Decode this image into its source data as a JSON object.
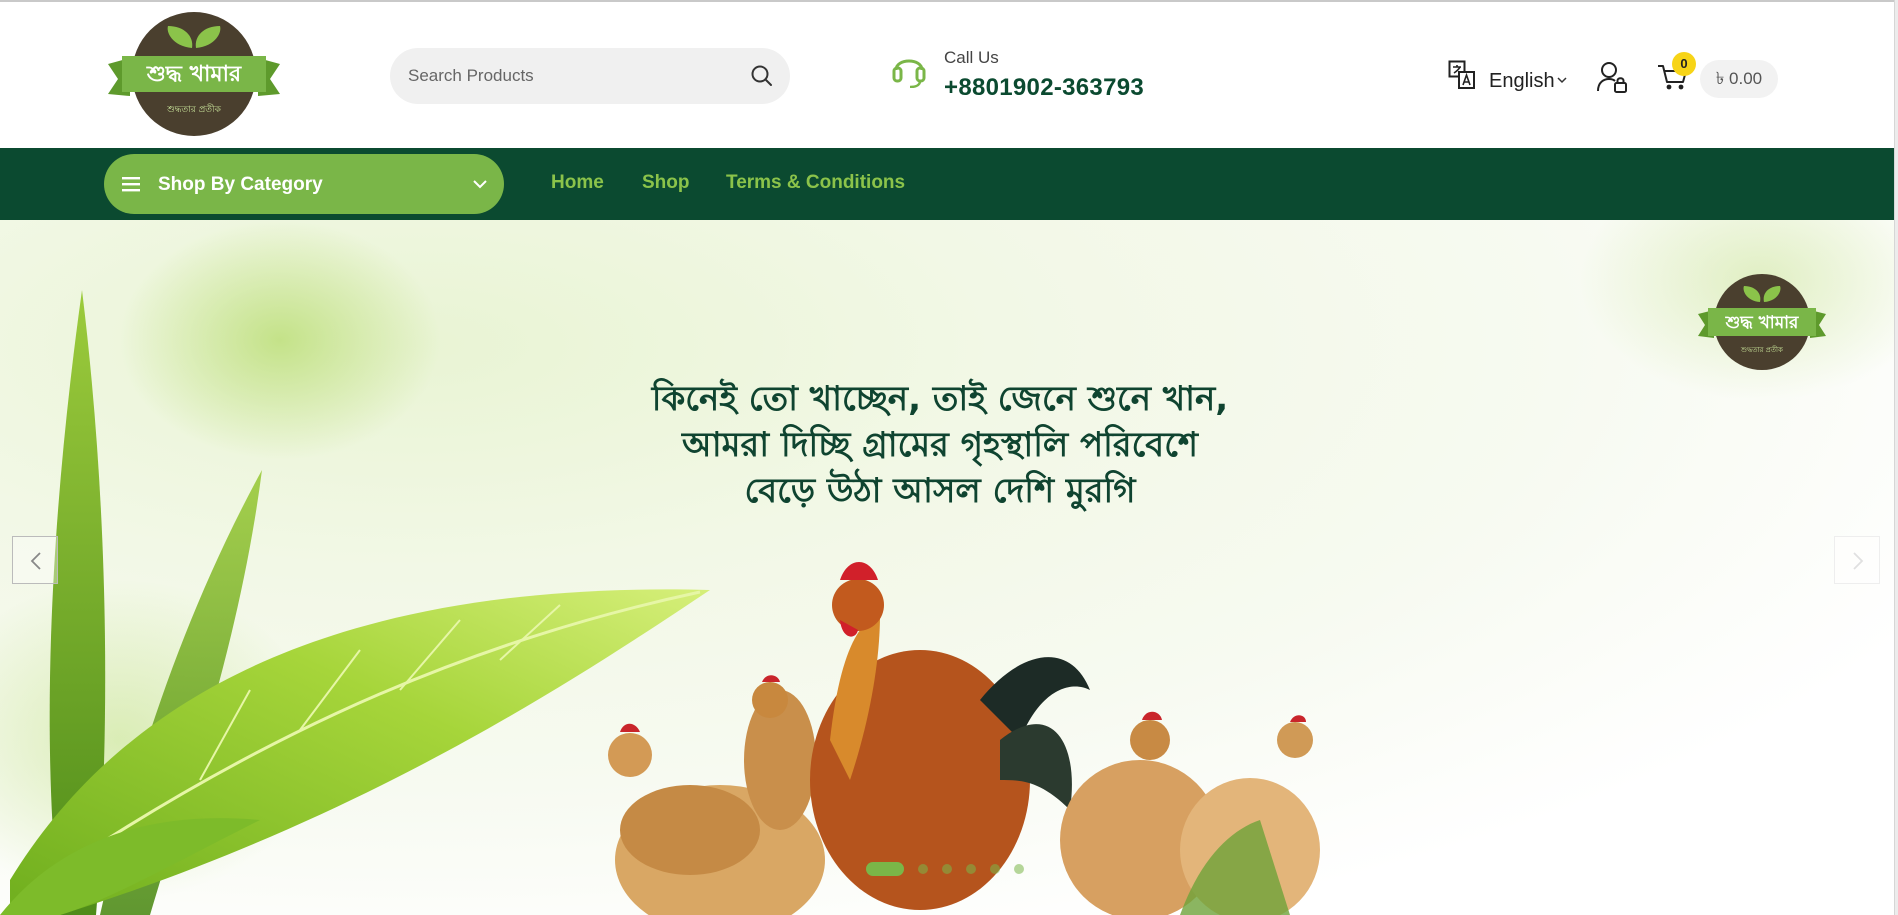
{
  "brand": {
    "logo_text": "শুদ্ধ খামার",
    "logo_tagline": "শুদ্ধতার প্রতীক"
  },
  "search": {
    "placeholder": "Search Products"
  },
  "contact": {
    "label": "Call Us",
    "phone": "+8801902-363793"
  },
  "header_actions": {
    "language": "English",
    "cart_count": "0",
    "cart_total": "৳ 0.00"
  },
  "nav": {
    "category_button": "Shop By Category",
    "links": [
      "Home",
      "Shop",
      "Terms & Conditions"
    ]
  },
  "hero": {
    "lines": [
      "কিনেই তো খাচ্ছেন, তাই জেনে শুনে খান,",
      "আমরা দিচ্ছি গ্রামের গৃহস্থালি পরিবেশে",
      "বেড়ে উঠা আসল দেশি মুরগি"
    ],
    "slide_count": 6,
    "active_slide": 1
  },
  "colors": {
    "primary_dark": "#0b4a30",
    "accent_green": "#7ab648",
    "nav_link": "#8bc34a",
    "badge_yellow": "#f7d417",
    "logo_brown": "#4a3f2e"
  }
}
